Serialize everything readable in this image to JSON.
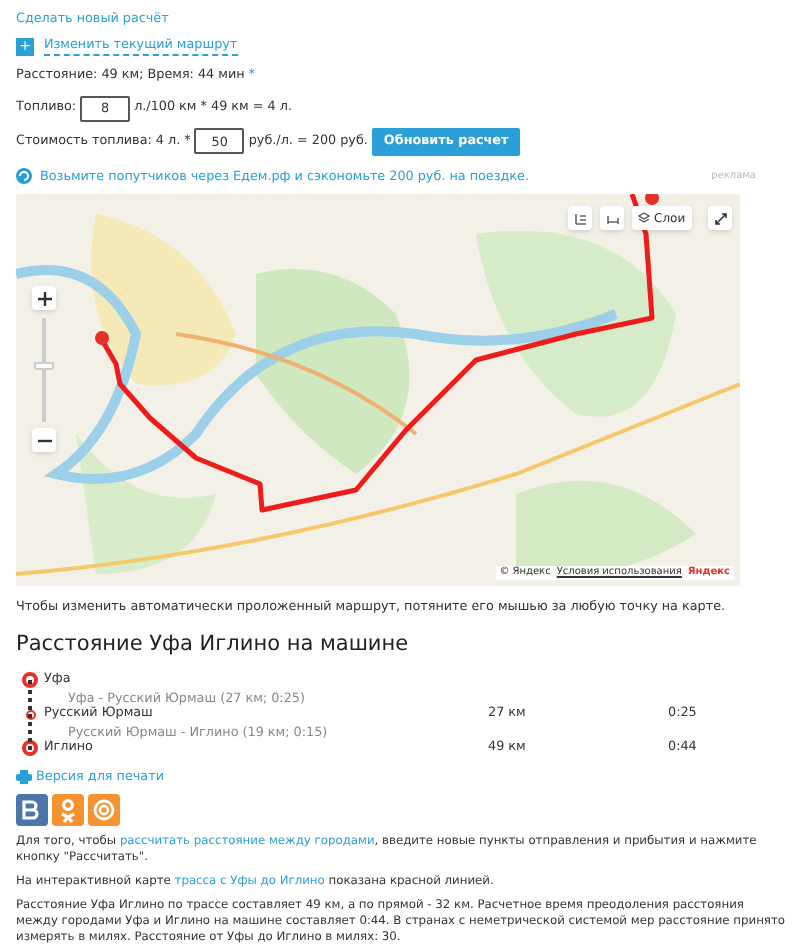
{
  "new_calc_link": "Сделать новый расчёт",
  "change_route": {
    "icon": "+",
    "label": "Изменить текущий маршрут"
  },
  "summary": {
    "text": "Расстояние: 49 км; Время: 44 мин",
    "mark": "*"
  },
  "fuel": {
    "label": "Топливо:",
    "value": "8",
    "formula": "л./100 км * 49 км = 4 л."
  },
  "cost": {
    "label": "Стоимость топлива: 4 л. *",
    "value": "50",
    "formula": "руб./л. = 200 руб.",
    "button": "Обновить расчет"
  },
  "ad": {
    "text": "Возьмите попутчиков через Едем.рф и сэкономьте 200 руб. на поездке.",
    "tag": "реклама"
  },
  "map": {
    "zoom": {
      "level": 0.55
    },
    "layers_button": "Слои",
    "attribution": "© Яндекс",
    "terms_link": "Условия использования",
    "logo": "Яндекс"
  },
  "map_hint": "Чтобы изменить автоматически проложенный маршрут, потяните его мышью за любую точку на карте.",
  "route_heading": "Расстояние Уфа Иглино на машине",
  "route": [
    {
      "kind": "endpoint",
      "name": "Уфа"
    },
    {
      "kind": "leg",
      "text": "Уфа - Русский Юрмаш (27 км; 0:25)"
    },
    {
      "kind": "waypoint",
      "name": "Русский Юрмаш",
      "distance": "27 км",
      "time": "0:25"
    },
    {
      "kind": "leg",
      "text": "Русский Юрмаш - Иглино (19 км; 0:15)"
    },
    {
      "kind": "endpoint",
      "name": "Иглино",
      "distance": "49 км",
      "time": "0:44"
    }
  ],
  "print_link": "Версия для печати",
  "share": [
    {
      "kind": "vk",
      "color": "#4a76a8"
    },
    {
      "kind": "ok",
      "color": "#f59331"
    },
    {
      "kind": "mail",
      "color": "#f59331"
    }
  ],
  "paragraphs": [
    [
      {
        "text": "Для того, чтобы "
      },
      {
        "link": "рассчитать расстояние между городами"
      },
      {
        "text": ", введите новые пункты отправления и прибытия и нажмите кнопку \"Рассчитать\"."
      }
    ],
    [
      {
        "text": "На интерактивной карте "
      },
      {
        "link": "трасса с Уфы до Иглино"
      },
      {
        "text": " показана красной линией."
      }
    ],
    [
      {
        "text": "Расстояние Уфа Иглино по трассе составляет 49 км, а по прямой - 32 км. Расчетное время преодоления расстояния между городами Уфа и Иглино на машине составляет 0:44. В странах с неметрической системой мер расстояние принято измерять в милях. Расстояние от Уфы до Иглино в милях: 30."
      }
    ]
  ]
}
